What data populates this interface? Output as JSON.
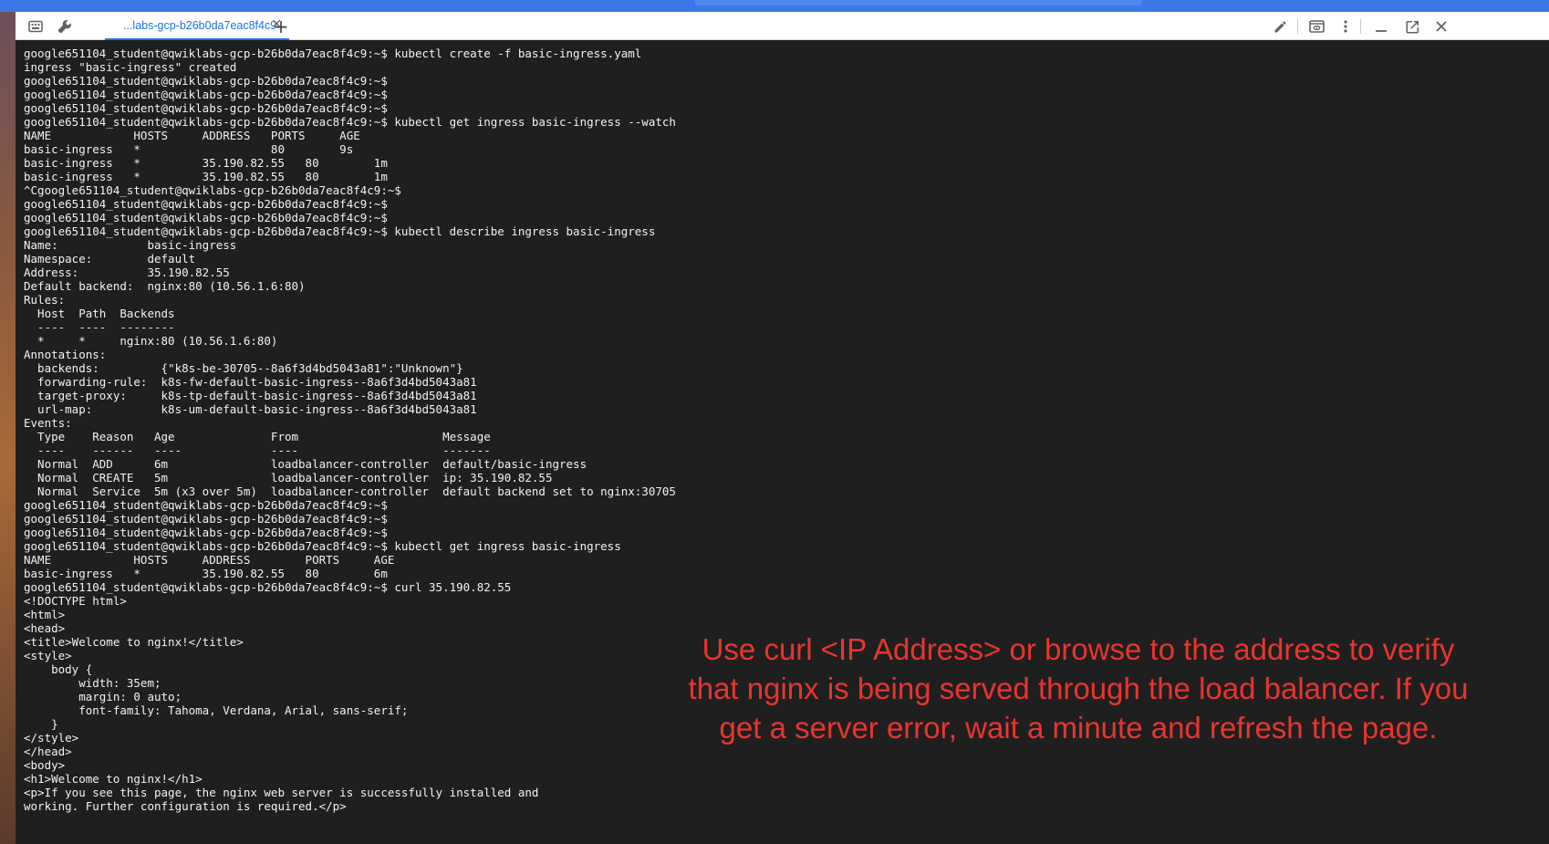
{
  "tab": {
    "title": "...labs-gcp-b26b0da7eac8f4c9"
  },
  "terminal": {
    "lines": [
      "google651104_student@qwiklabs-gcp-b26b0da7eac8f4c9:~$ kubectl create -f basic-ingress.yaml",
      "ingress \"basic-ingress\" created",
      "google651104_student@qwiklabs-gcp-b26b0da7eac8f4c9:~$",
      "google651104_student@qwiklabs-gcp-b26b0da7eac8f4c9:~$",
      "google651104_student@qwiklabs-gcp-b26b0da7eac8f4c9:~$",
      "google651104_student@qwiklabs-gcp-b26b0da7eac8f4c9:~$ kubectl get ingress basic-ingress --watch",
      "NAME            HOSTS     ADDRESS   PORTS     AGE",
      "basic-ingress   *                   80        9s",
      "basic-ingress   *         35.190.82.55   80        1m",
      "basic-ingress   *         35.190.82.55   80        1m",
      "^Cgoogle651104_student@qwiklabs-gcp-b26b0da7eac8f4c9:~$",
      "google651104_student@qwiklabs-gcp-b26b0da7eac8f4c9:~$",
      "google651104_student@qwiklabs-gcp-b26b0da7eac8f4c9:~$",
      "google651104_student@qwiklabs-gcp-b26b0da7eac8f4c9:~$ kubectl describe ingress basic-ingress",
      "Name:             basic-ingress",
      "Namespace:        default",
      "Address:          35.190.82.55",
      "Default backend:  nginx:80 (10.56.1.6:80)",
      "Rules:",
      "  Host  Path  Backends",
      "  ----  ----  --------",
      "  *     *     nginx:80 (10.56.1.6:80)",
      "Annotations:",
      "  backends:         {\"k8s-be-30705--8a6f3d4bd5043a81\":\"Unknown\"}",
      "  forwarding-rule:  k8s-fw-default-basic-ingress--8a6f3d4bd5043a81",
      "  target-proxy:     k8s-tp-default-basic-ingress--8a6f3d4bd5043a81",
      "  url-map:          k8s-um-default-basic-ingress--8a6f3d4bd5043a81",
      "Events:",
      "  Type    Reason   Age              From                     Message",
      "  ----    ------   ----             ----                     -------",
      "  Normal  ADD      6m               loadbalancer-controller  default/basic-ingress",
      "  Normal  CREATE   5m               loadbalancer-controller  ip: 35.190.82.55",
      "  Normal  Service  5m (x3 over 5m)  loadbalancer-controller  default backend set to nginx:30705",
      "google651104_student@qwiklabs-gcp-b26b0da7eac8f4c9:~$",
      "google651104_student@qwiklabs-gcp-b26b0da7eac8f4c9:~$",
      "google651104_student@qwiklabs-gcp-b26b0da7eac8f4c9:~$",
      "google651104_student@qwiklabs-gcp-b26b0da7eac8f4c9:~$ kubectl get ingress basic-ingress",
      "NAME            HOSTS     ADDRESS        PORTS     AGE",
      "basic-ingress   *         35.190.82.55   80        6m",
      "google651104_student@qwiklabs-gcp-b26b0da7eac8f4c9:~$ curl 35.190.82.55",
      "<!DOCTYPE html>",
      "<html>",
      "<head>",
      "<title>Welcome to nginx!</title>",
      "<style>",
      "    body {",
      "        width: 35em;",
      "        margin: 0 auto;",
      "        font-family: Tahoma, Verdana, Arial, sans-serif;",
      "    }",
      "</style>",
      "</head>",
      "<body>",
      "<h1>Welcome to nginx!</h1>",
      "<p>If you see this page, the nginx web server is successfully installed and",
      "working. Further configuration is required.</p>"
    ]
  },
  "annotation": {
    "lines": [
      "Use curl <IP Address> or browse to the address to verify",
      "that nginx is being served through the load balancer. If you",
      "get a server error, wait a minute and refresh the page."
    ],
    "color": "#e8352e"
  },
  "icons": {
    "keyboard": "keyboard-icon",
    "settings": "wrench-icon",
    "close_tab": "close-icon",
    "new_tab": "plus-icon",
    "edit": "pencil-icon",
    "preview": "web-preview-icon",
    "more": "more-vert-icon",
    "minimize": "minimize-icon",
    "popout": "open-in-new-icon",
    "close_window": "close-icon"
  }
}
